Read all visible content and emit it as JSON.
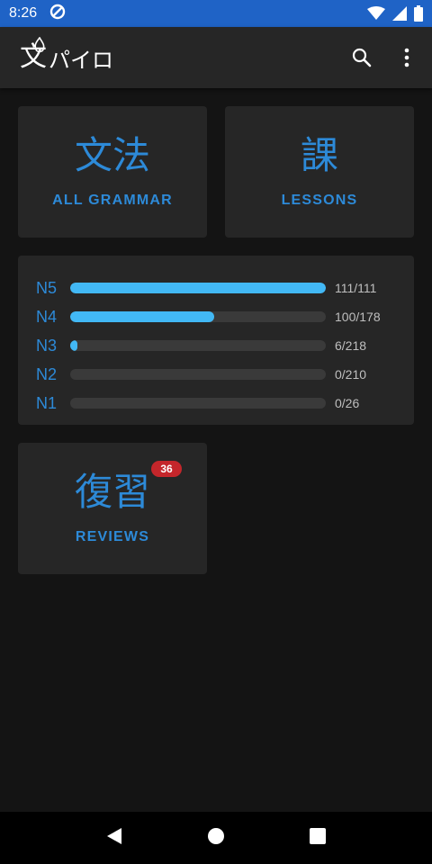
{
  "status_bar": {
    "time": "8:26"
  },
  "app_bar": {
    "logo_kanji": "文",
    "logo_text": "パイロ"
  },
  "tiles": {
    "grammar": {
      "kanji": "文法",
      "caption": "ALL GRAMMAR"
    },
    "lessons": {
      "kanji": "課",
      "caption": "LESSONS"
    },
    "reviews": {
      "kanji": "復習",
      "caption": "REVIEWS",
      "badge": "36"
    }
  },
  "levels": [
    {
      "name": "N5",
      "count": "111/111",
      "progress": 1.0
    },
    {
      "name": "N4",
      "count": "100/178",
      "progress": 0.562
    },
    {
      "name": "N3",
      "count": "6/218",
      "progress": 0.0275
    },
    {
      "name": "N2",
      "count": "0/210",
      "progress": 0
    },
    {
      "name": "N1",
      "count": "0/26",
      "progress": 0
    }
  ],
  "colors": {
    "accent": "#2d8ad8",
    "progress_fill": "#42b8f5",
    "status_bar": "#1f63c6",
    "badge": "#c4262b"
  }
}
